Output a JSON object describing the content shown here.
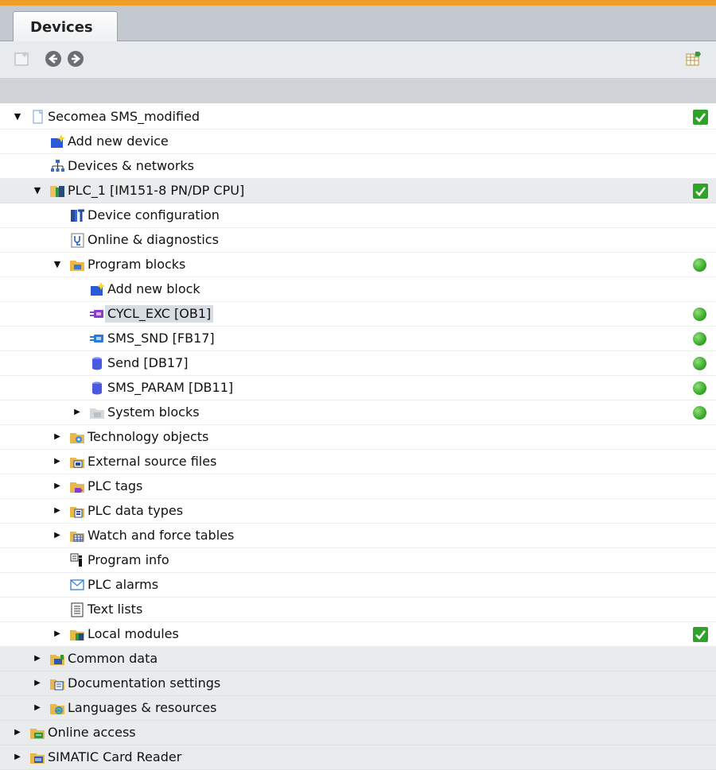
{
  "tab": {
    "title": "Devices"
  },
  "toolbar": {
    "left": [
      "new-folder-icon",
      "back-icon",
      "forward-icon"
    ],
    "right": "table-view-icon"
  },
  "tree": [
    {
      "label": "Secomea SMS_modified",
      "level": 0,
      "arrow": "down",
      "icon": "project-icon",
      "status": "check",
      "shaded": false
    },
    {
      "label": "Add new device",
      "level": 1,
      "arrow": "",
      "icon": "add-device-icon",
      "status": "",
      "shaded": false
    },
    {
      "label": "Devices & networks",
      "level": 1,
      "arrow": "",
      "icon": "network-icon",
      "status": "",
      "shaded": false
    },
    {
      "label": "PLC_1 [IM151-8 PN/DP CPU]",
      "level": 1,
      "arrow": "down",
      "icon": "plc-icon",
      "status": "check",
      "shaded": true
    },
    {
      "label": "Device configuration",
      "level": 2,
      "arrow": "",
      "icon": "device-config-icon",
      "status": "",
      "shaded": false
    },
    {
      "label": "Online & diagnostics",
      "level": 2,
      "arrow": "",
      "icon": "diagnostics-icon",
      "status": "",
      "shaded": false
    },
    {
      "label": "Program blocks",
      "level": 2,
      "arrow": "down",
      "icon": "folder-blocks-icon",
      "status": "dot",
      "shaded": false
    },
    {
      "label": "Add new block",
      "level": 3,
      "arrow": "",
      "icon": "add-block-icon",
      "status": "",
      "shaded": false
    },
    {
      "label": "CYCL_EXC [OB1]",
      "level": 3,
      "arrow": "",
      "icon": "ob-block-icon",
      "status": "dot",
      "shaded": false,
      "selected": true
    },
    {
      "label": "SMS_SND [FB17]",
      "level": 3,
      "arrow": "",
      "icon": "fb-block-icon",
      "status": "dot",
      "shaded": false
    },
    {
      "label": "Send [DB17]",
      "level": 3,
      "arrow": "",
      "icon": "db-block-icon",
      "status": "dot",
      "shaded": false
    },
    {
      "label": "SMS_PARAM [DB11]",
      "level": 3,
      "arrow": "",
      "icon": "db-block-icon",
      "status": "dot",
      "shaded": false
    },
    {
      "label": "System blocks",
      "level": 3,
      "arrow": "right",
      "icon": "folder-system-icon",
      "status": "dot",
      "shaded": false
    },
    {
      "label": "Technology objects",
      "level": 2,
      "arrow": "right",
      "icon": "folder-tech-icon",
      "status": "",
      "shaded": false
    },
    {
      "label": "External source files",
      "level": 2,
      "arrow": "right",
      "icon": "folder-source-icon",
      "status": "",
      "shaded": false
    },
    {
      "label": "PLC tags",
      "level": 2,
      "arrow": "right",
      "icon": "folder-tags-icon",
      "status": "",
      "shaded": false
    },
    {
      "label": "PLC data types",
      "level": 2,
      "arrow": "right",
      "icon": "folder-types-icon",
      "status": "",
      "shaded": false
    },
    {
      "label": "Watch and force tables",
      "level": 2,
      "arrow": "right",
      "icon": "folder-watch-icon",
      "status": "",
      "shaded": false
    },
    {
      "label": "Program info",
      "level": 2,
      "arrow": "",
      "icon": "program-info-icon",
      "status": "",
      "shaded": false
    },
    {
      "label": "PLC alarms",
      "level": 2,
      "arrow": "",
      "icon": "alarm-envelope-icon",
      "status": "",
      "shaded": false
    },
    {
      "label": "Text lists",
      "level": 2,
      "arrow": "",
      "icon": "text-list-icon",
      "status": "",
      "shaded": false
    },
    {
      "label": "Local modules",
      "level": 2,
      "arrow": "right",
      "icon": "folder-modules-icon",
      "status": "check",
      "shaded": false
    },
    {
      "label": "Common data",
      "level": 1,
      "arrow": "right",
      "icon": "folder-common-icon",
      "status": "",
      "shaded": true
    },
    {
      "label": "Documentation settings",
      "level": 1,
      "arrow": "right",
      "icon": "folder-docs-icon",
      "status": "",
      "shaded": true
    },
    {
      "label": "Languages & resources",
      "level": 1,
      "arrow": "right",
      "icon": "folder-languages-icon",
      "status": "",
      "shaded": true
    },
    {
      "label": "Online access",
      "level": 0,
      "arrow": "right",
      "icon": "folder-online-icon",
      "status": "",
      "shaded": true
    },
    {
      "label": "SIMATIC Card Reader",
      "level": 0,
      "arrow": "right",
      "icon": "folder-card-icon",
      "status": "",
      "shaded": true
    }
  ],
  "colors": {
    "accent": "#f0a028",
    "status_green": "#3aa82a",
    "folder": "#e8b84a",
    "block_purple": "#8a3ec8",
    "block_blue": "#2a7ad8"
  }
}
